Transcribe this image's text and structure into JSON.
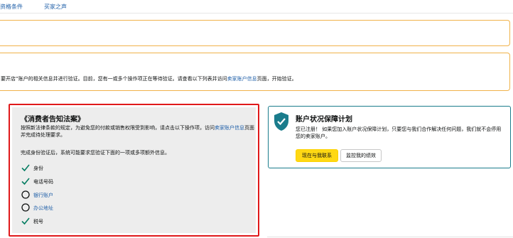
{
  "tabs": [
    {
      "label": "资格条件"
    },
    {
      "label": "买家之声"
    }
  ],
  "alert_verification": {
    "text_before": "要开店”账户的相关信息并进行验证。目前，您有一或多个操作项正在等待验证。请查看以下列表并访问",
    "link_text": "卖家账户信息",
    "text_after": "页面，开始验证。"
  },
  "consumer_panel": {
    "title": "《消费者告知法案》",
    "desc_before": "按照新法律条款的规定，为避免您的付款或销售权限受到影响，请点击以下操作项，访问",
    "desc_link": "卖家账户信息",
    "desc_after": "页面并完成待处理要求。",
    "note": "完成身份验证后，系统可能要求您验证下面的一项或多项额外信息。",
    "requirements": [
      {
        "label": "身份",
        "status": "done"
      },
      {
        "label": "电话号码",
        "status": "done"
      },
      {
        "label": "银行账户",
        "status": "pending"
      },
      {
        "label": "办公地址",
        "status": "pending"
      },
      {
        "label": "税号",
        "status": "done"
      }
    ]
  },
  "account_panel": {
    "title": "账户状况保障计划",
    "desc": "您已注册！ 如果您加入账户状况保障计划，只要您与我们合作解决任何问题，我们就不会停用您的卖家账户。",
    "primary_button": "现在与我联系",
    "secondary_button": "监控我的绩效"
  },
  "colors": {
    "link": "#1f5fa8",
    "alert_border": "#f0b24a",
    "highlight_border": "#e0191b",
    "check": "#067d62",
    "teal": "#1a7c8c",
    "primary_button": "#ffd814"
  },
  "icons": {
    "done": "check-icon",
    "pending": "empty-circle-icon",
    "account": "shield-check-icon"
  }
}
